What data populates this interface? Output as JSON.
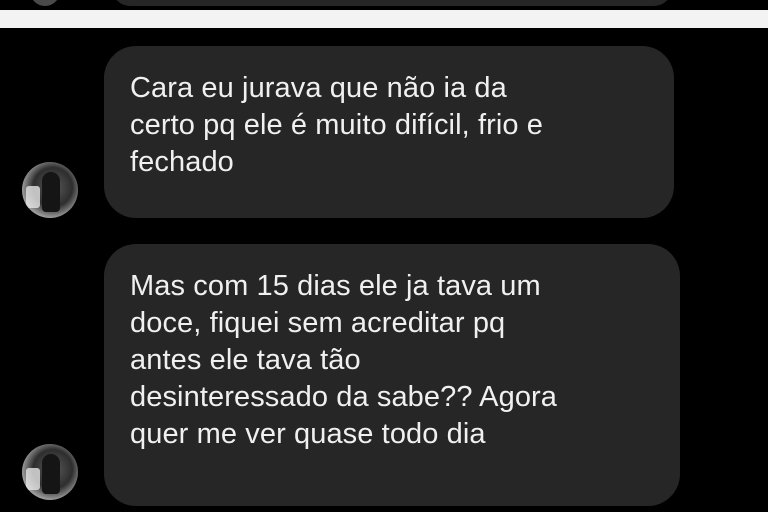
{
  "conversation": {
    "messages": [
      {
        "lines": [
          "Cara eu jurava que não ia da",
          "certo pq ele é muito difícil, frio e",
          "fechado"
        ]
      },
      {
        "lines": [
          "Mas com 15 dias ele ja tava um",
          "doce, fiquei sem acreditar pq",
          "antes ele tava tão",
          "desinteressado da sabe?? Agora",
          "quer me ver quase todo dia"
        ]
      }
    ]
  },
  "colors": {
    "background": "#000000",
    "bubble": "#262626",
    "text": "#f0f0f0",
    "separator": "#f3f3f3"
  },
  "icons": {
    "avatar": "profile-photo"
  }
}
